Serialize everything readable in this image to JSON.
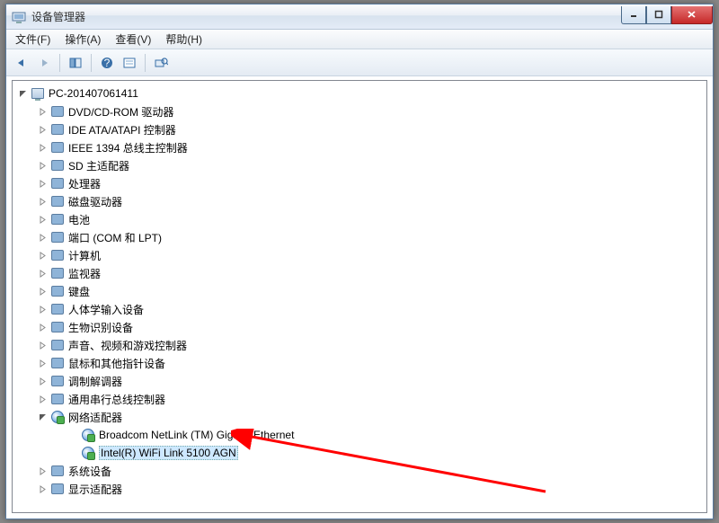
{
  "window": {
    "title": "设备管理器"
  },
  "menu": {
    "file": "文件(F)",
    "action": "操作(A)",
    "view": "查看(V)",
    "help": "帮助(H)"
  },
  "root": {
    "label": "PC-201407061411"
  },
  "categories": [
    {
      "label": "DVD/CD-ROM 驱动器",
      "icon": "disc",
      "expanded": false
    },
    {
      "label": "IDE ATA/ATAPI 控制器",
      "icon": "ide",
      "expanded": false
    },
    {
      "label": "IEEE 1394 总线主控制器",
      "icon": "1394",
      "expanded": false
    },
    {
      "label": "SD 主适配器",
      "icon": "sd",
      "expanded": false
    },
    {
      "label": "处理器",
      "icon": "cpu",
      "expanded": false
    },
    {
      "label": "磁盘驱动器",
      "icon": "disk",
      "expanded": false
    },
    {
      "label": "电池",
      "icon": "battery",
      "expanded": false
    },
    {
      "label": "端口 (COM 和 LPT)",
      "icon": "port",
      "expanded": false
    },
    {
      "label": "计算机",
      "icon": "computer",
      "expanded": false
    },
    {
      "label": "监视器",
      "icon": "monitor",
      "expanded": false
    },
    {
      "label": "键盘",
      "icon": "keyboard",
      "expanded": false
    },
    {
      "label": "人体学输入设备",
      "icon": "hid",
      "expanded": false
    },
    {
      "label": "生物识别设备",
      "icon": "bio",
      "expanded": false
    },
    {
      "label": "声音、视频和游戏控制器",
      "icon": "sound",
      "expanded": false
    },
    {
      "label": "鼠标和其他指针设备",
      "icon": "mouse",
      "expanded": false
    },
    {
      "label": "调制解调器",
      "icon": "modem",
      "expanded": false
    },
    {
      "label": "通用串行总线控制器",
      "icon": "usb",
      "expanded": false
    },
    {
      "label": "网络适配器",
      "icon": "network",
      "expanded": true,
      "children": [
        {
          "label": "Broadcom NetLink (TM) Gigabit Ethernet",
          "icon": "netadapter"
        },
        {
          "label": "Intel(R) WiFi Link 5100 AGN",
          "icon": "netadapter",
          "selected": true
        }
      ]
    },
    {
      "label": "系统设备",
      "icon": "system",
      "expanded": false
    },
    {
      "label": "显示适配器",
      "icon": "display",
      "expanded": false
    }
  ]
}
